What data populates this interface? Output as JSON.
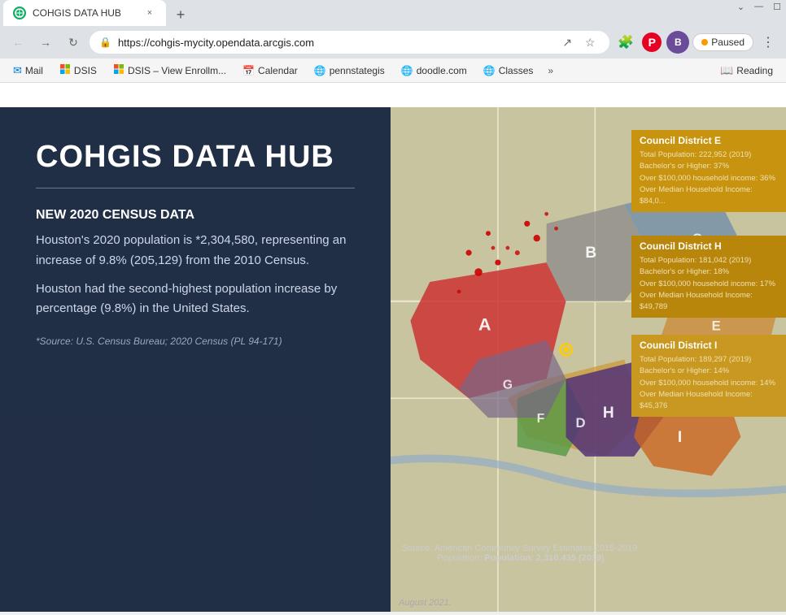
{
  "browser": {
    "tab": {
      "favicon_text": "🌐",
      "title": "COHGIS DATA HUB",
      "close_label": "×"
    },
    "new_tab_label": "+",
    "window_controls": {
      "minimize": "—",
      "maximize": "☐",
      "restore": "⌄"
    },
    "nav": {
      "back_label": "←",
      "forward_label": "→",
      "reload_label": "↻"
    },
    "address": "https://cohgis-mycity.opendata.arcgis.com",
    "profile_initial": "B",
    "paused_label": "Paused"
  },
  "bookmarks": [
    {
      "id": "mail",
      "label": "Mail",
      "icon_type": "outlook"
    },
    {
      "id": "dsis1",
      "label": "DSIS",
      "icon_type": "ms"
    },
    {
      "id": "dsis2",
      "label": "DSIS – View Enrollm...",
      "icon_type": "ms"
    },
    {
      "id": "calendar",
      "label": "Calendar",
      "icon_type": "outlook"
    },
    {
      "id": "pennstategis",
      "label": "pennstategis",
      "icon_type": "globe"
    },
    {
      "id": "doodle",
      "label": "doodle.com",
      "icon_type": "globe"
    },
    {
      "id": "classes",
      "label": "Classes",
      "icon_type": "globe"
    }
  ],
  "bookmarks_more_label": "»",
  "reading_label": "Reading",
  "new_tab_section": {
    "label": ""
  },
  "hero": {
    "title": "COHGIS DATA HUB",
    "divider": true,
    "census_heading": "NEW 2020 CENSUS DATA",
    "census_body_1": "Houston's 2020 population is *2,304,580, representing an increase of 9.8% (205,129) from the 2010 Census.",
    "census_body_2": "Houston had the second-highest population increase by percentage (9.8%) in the United States.",
    "census_source": "*Source: U.S. Census Bureau; 2020 Census (PL 94-171)"
  },
  "council_districts": [
    {
      "id": "E",
      "name": "Council District E",
      "stats": [
        "Total Population: 222,952 (2019)",
        "Bachelor's or Higher: 37%",
        "Over $100,000 household income: 36%",
        "Over Median Household Income: $84,0..."
      ]
    },
    {
      "id": "H",
      "name": "Council District H",
      "stats": [
        "Total Population: 181,042 (2019)",
        "Bachelor's or Higher: 18%",
        "Over $100,000 household income: 17%",
        "Over Median Household Income: $49,789"
      ]
    },
    {
      "id": "I",
      "name": "Council District I",
      "stats": [
        "Total Population: 189,297 (2019)",
        "Bachelor's or Higher: 14%",
        "Over $100,000 household income: 14%",
        "Over Median Household Income: $45,376"
      ]
    }
  ],
  "map_source": "Source: American Community Survey Estimates 2015-2019.",
  "map_population": "Population: 2,310,435 (2019)",
  "august_note": "August 2021."
}
